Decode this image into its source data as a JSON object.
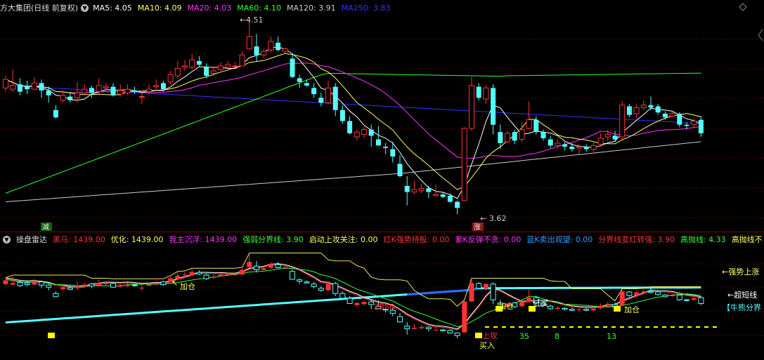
{
  "main_panel": {
    "stock_name": "方大集团(日线 前复权)",
    "indicators": [
      {
        "label": "MA5: 4.05",
        "color": "#ffffff"
      },
      {
        "label": "MA10: 4.09",
        "color": "#ffff66"
      },
      {
        "label": "MA20: 4.03",
        "color": "#ff33ff"
      },
      {
        "label": "MA60: 4.10",
        "color": "#33ff33"
      },
      {
        "label": "MA120: 3.91",
        "color": "#cccccc"
      },
      {
        "label": "MA250: 3.83",
        "color": "#3333ff"
      }
    ],
    "high_label": "4.51",
    "low_label": "3.62",
    "jian_badge": "减",
    "zhang_badge": "涨"
  },
  "sub_panel": {
    "title": "操盘雷达",
    "indicators": [
      {
        "label": "黑马: 1439.00",
        "color": "#ff3333"
      },
      {
        "label": "优化: 1439.00",
        "color": "#ffff66"
      },
      {
        "label": "我主沉浮: 1439.00",
        "color": "#ff33ff"
      },
      {
        "label": "强弱分界线: 3.90",
        "color": "#33ff33"
      },
      {
        "label": "启动上攻关注: 0.00",
        "color": "#ffff66"
      },
      {
        "label": "红K强势持股: 0.00",
        "color": "#ff3333"
      },
      {
        "label": "紫K反弹不贪: 0.00",
        "color": "#ff33ff"
      },
      {
        "label": "蓝K卖出观望: 0.00",
        "color": "#3399ff"
      },
      {
        "label": "分界线变红转强: 3.90",
        "color": "#ff3333"
      },
      {
        "label": "高抛线: 4.33",
        "color": "#33ff33"
      },
      {
        "label": "高抛线不",
        "color": "#ffff66"
      }
    ],
    "annotations": {
      "jiacang1": "加仓",
      "jiacang2": "加仓",
      "jiacang3": "加仓",
      "disai": "低买",
      "zbsd": "ZBSD",
      "shanggong": "上攻",
      "mairu": "买入",
      "num3": "3",
      "num5": "5",
      "num8": "8",
      "num13": "13",
      "qiangshi": "←强势上涨",
      "chaoduan": "←超短线",
      "niuxiong": "【牛熊分界"
    }
  },
  "colors": {
    "up": "#ff3333",
    "down": "#54ffff",
    "ma5": "#ffffff",
    "ma10": "#ffff66",
    "ma20": "#ff33ff",
    "ma60": "#33ff33",
    "ma120": "#cccccc",
    "ma250": "#3333ff",
    "grid": "#5a0000"
  },
  "candles_main": [
    [
      3.98,
      4.05,
      4.08,
      3.95
    ],
    [
      3.97,
      4.0,
      4.13,
      3.95
    ],
    [
      4.01,
      3.95,
      4.06,
      3.92
    ],
    [
      4.0,
      3.97,
      4.04,
      3.93
    ],
    [
      3.97,
      4.02,
      4.07,
      3.96
    ],
    [
      4.02,
      3.96,
      4.05,
      3.9
    ],
    [
      3.96,
      3.92,
      3.99,
      3.86
    ],
    [
      3.8,
      3.74,
      3.84,
      3.73
    ],
    [
      3.88,
      3.92,
      3.96,
      3.86
    ],
    [
      3.91,
      3.88,
      3.95,
      3.86
    ],
    [
      3.9,
      3.94,
      4.03,
      3.86
    ],
    [
      3.94,
      3.97,
      4.01,
      3.92
    ],
    [
      3.98,
      3.94,
      4.0,
      3.9
    ],
    [
      3.95,
      4.0,
      4.06,
      3.93
    ],
    [
      3.98,
      3.99,
      4.02,
      3.96
    ],
    [
      3.99,
      3.92,
      4.02,
      3.91
    ],
    [
      3.93,
      3.96,
      4.01,
      3.91
    ],
    [
      3.94,
      3.97,
      4.01,
      3.92
    ],
    [
      3.96,
      3.95,
      3.99,
      3.93
    ],
    [
      3.91,
      3.91,
      3.96,
      3.85
    ],
    [
      3.95,
      3.97,
      4.01,
      3.93
    ],
    [
      3.99,
      4.0,
      4.05,
      3.96
    ],
    [
      4.02,
      3.97,
      4.04,
      3.95
    ],
    [
      4.03,
      4.09,
      4.12,
      4.01
    ],
    [
      4.08,
      4.14,
      4.2,
      4.06
    ],
    [
      4.15,
      4.16,
      4.21,
      4.12
    ],
    [
      4.15,
      4.21,
      4.26,
      4.13
    ],
    [
      4.2,
      4.17,
      4.24,
      4.15
    ],
    [
      4.15,
      4.08,
      4.18,
      4.06
    ],
    [
      4.1,
      4.12,
      4.16,
      4.08
    ],
    [
      4.13,
      4.16,
      4.19,
      4.12
    ],
    [
      4.15,
      4.17,
      4.2,
      4.14
    ],
    [
      4.16,
      4.16,
      4.19,
      4.14
    ],
    [
      4.16,
      4.25,
      4.28,
      4.16
    ],
    [
      4.3,
      4.4,
      4.55,
      4.3
    ],
    [
      4.32,
      4.25,
      4.42,
      4.2
    ],
    [
      4.25,
      4.28,
      4.3,
      4.23
    ],
    [
      4.29,
      4.36,
      4.4,
      4.27
    ],
    [
      4.35,
      4.29,
      4.4,
      4.28
    ],
    [
      4.28,
      4.3,
      4.31,
      4.26
    ],
    [
      4.22,
      4.07,
      4.26,
      4.06
    ],
    [
      4.06,
      4.03,
      4.09,
      3.98
    ],
    [
      4.02,
      4.0,
      4.05,
      3.99
    ],
    [
      3.98,
      3.93,
      4.02,
      3.9
    ],
    [
      3.9,
      3.86,
      3.94,
      3.83
    ],
    [
      3.86,
      3.98,
      4.04,
      3.85
    ],
    [
      3.99,
      3.8,
      4.02,
      3.75
    ],
    [
      3.8,
      3.71,
      3.84,
      3.69
    ],
    [
      3.71,
      3.61,
      3.75,
      3.6
    ],
    [
      3.58,
      3.62,
      3.64,
      3.55
    ],
    [
      3.6,
      3.64,
      3.66,
      3.57
    ],
    [
      3.64,
      3.59,
      3.68,
      3.5
    ],
    [
      3.56,
      3.51,
      3.67,
      3.51
    ],
    [
      3.5,
      3.49,
      3.53,
      3.44
    ],
    [
      3.48,
      3.42,
      3.54,
      3.37
    ],
    [
      3.36,
      3.26,
      3.43,
      3.25
    ],
    [
      3.18,
      3.13,
      3.26,
      3.02
    ],
    [
      3.13,
      3.15,
      3.22,
      3.11
    ],
    [
      3.14,
      3.16,
      3.2,
      3.12
    ],
    [
      3.16,
      3.13,
      3.18,
      3.08
    ],
    [
      3.1,
      3.11,
      3.19,
      3.1
    ],
    [
      3.11,
      3.09,
      3.13,
      3.08
    ],
    [
      3.1,
      3.05,
      3.12,
      3.04
    ],
    [
      3.05,
      3.0,
      3.06,
      2.95
    ],
    [
      3.06,
      3.65,
      3.66,
      3.06
    ],
    [
      3.65,
      4.0,
      4.07,
      3.63
    ],
    [
      3.99,
      3.9,
      4.02,
      3.88
    ],
    [
      3.89,
      3.98,
      4.0,
      3.85
    ],
    [
      3.98,
      3.68,
      4.01,
      3.6
    ],
    [
      3.62,
      3.53,
      3.68,
      3.48
    ],
    [
      3.54,
      3.61,
      3.63,
      3.53
    ],
    [
      3.62,
      3.55,
      3.64,
      3.52
    ],
    [
      3.56,
      3.64,
      3.7,
      3.54
    ],
    [
      3.65,
      3.72,
      3.87,
      3.64
    ],
    [
      3.72,
      3.62,
      3.75,
      3.6
    ],
    [
      3.62,
      3.57,
      3.64,
      3.55
    ],
    [
      3.56,
      3.51,
      3.59,
      3.49
    ],
    [
      3.51,
      3.53,
      3.56,
      3.48
    ],
    [
      3.52,
      3.5,
      3.54,
      3.47
    ],
    [
      3.5,
      3.48,
      3.53,
      3.46
    ],
    [
      3.49,
      3.5,
      3.52,
      3.44
    ],
    [
      3.5,
      3.48,
      3.52,
      3.46
    ],
    [
      3.48,
      3.51,
      3.55,
      3.46
    ],
    [
      3.52,
      3.57,
      3.61,
      3.5
    ],
    [
      3.58,
      3.6,
      3.64,
      3.55
    ],
    [
      3.59,
      3.56,
      3.63,
      3.54
    ],
    [
      3.58,
      3.84,
      3.87,
      3.56
    ],
    [
      3.83,
      3.76,
      3.85,
      3.74
    ],
    [
      3.77,
      3.82,
      3.85,
      3.74
    ],
    [
      3.82,
      3.84,
      3.88,
      3.8
    ],
    [
      3.84,
      3.82,
      3.91,
      3.8
    ],
    [
      3.83,
      3.78,
      3.85,
      3.76
    ],
    [
      3.77,
      3.74,
      3.79,
      3.72
    ],
    [
      3.75,
      3.77,
      3.79,
      3.74
    ],
    [
      3.77,
      3.68,
      3.78,
      3.66
    ],
    [
      3.68,
      3.67,
      3.7,
      3.64
    ],
    [
      3.68,
      3.71,
      3.73,
      3.66
    ],
    [
      3.72,
      3.61,
      3.75,
      3.58
    ]
  ],
  "zhang_index": 64,
  "jian_index": 5
}
